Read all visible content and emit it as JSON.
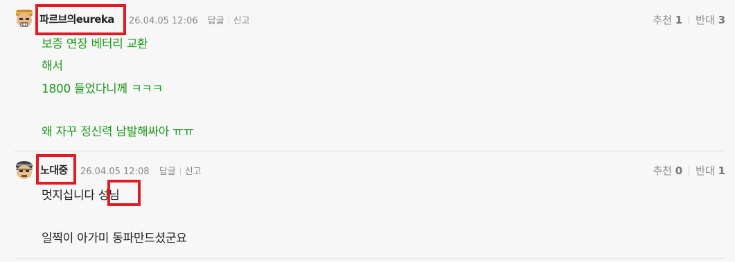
{
  "comments": [
    {
      "nickname": "파르브의eureka",
      "date": "26.04.05 12:06",
      "reply_label": "답글",
      "report_label": "신고",
      "like_label": "추천",
      "like_count": "1",
      "dislike_label": "반대",
      "dislike_count": "3",
      "lines": [
        "보증 연장 베터리 교환",
        "해서",
        "1800 들었다니께 ㅋㅋㅋ",
        "",
        "왜 자꾸 정신력 남발해싸아 ㅠㅠ"
      ],
      "text_color": "#1a9a1a"
    },
    {
      "nickname": "노대중",
      "date": "26.04.05 12:08",
      "reply_label": "답글",
      "report_label": "신고",
      "like_label": "추천",
      "like_count": "0",
      "dislike_label": "반대",
      "dislike_count": "1",
      "line1_prefix": "멋지십니다 ",
      "line1_highlight": "성님",
      "lines": [
        "",
        "일찍이 아가미 동파만드셨군요"
      ],
      "text_color": "#222222"
    }
  ],
  "highlight_color": "#e01b23"
}
